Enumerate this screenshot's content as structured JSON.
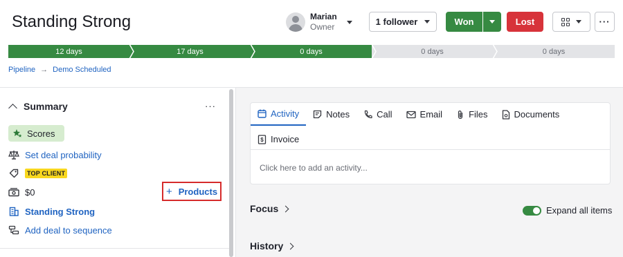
{
  "header": {
    "title": "Standing Strong",
    "owner": {
      "name": "Marian",
      "role": "Owner"
    },
    "follower_label": "1 follower",
    "won_label": "Won",
    "lost_label": "Lost"
  },
  "pipeline": {
    "stages": [
      {
        "label": "12 days",
        "status": "done"
      },
      {
        "label": "17 days",
        "status": "done"
      },
      {
        "label": "0 days",
        "status": "done"
      },
      {
        "label": "0 days",
        "status": "todo"
      },
      {
        "label": "0 days",
        "status": "todo"
      }
    ]
  },
  "breadcrumb": {
    "items": [
      "Pipeline",
      "Demo Scheduled"
    ]
  },
  "summary": {
    "title": "Summary",
    "scores_label": "Scores",
    "deal_probability": "Set deal probability",
    "tag": "TOP CLIENT",
    "value": "$0",
    "products_label": "Products",
    "organization": "Standing Strong",
    "sequence": "Add deal to sequence"
  },
  "activity": {
    "tabs": [
      "Activity",
      "Notes",
      "Call",
      "Email",
      "Files",
      "Documents",
      "Invoice"
    ],
    "placeholder": "Click here to add an activity..."
  },
  "sections": {
    "focus": "Focus",
    "history": "History",
    "expand_label": "Expand all items",
    "expand_on": true
  },
  "colors": {
    "won": "#368a42",
    "lost": "#d7333a",
    "link": "#1f63c1",
    "tag": "#f8d71e",
    "highlight_box": "#d62b2b"
  }
}
